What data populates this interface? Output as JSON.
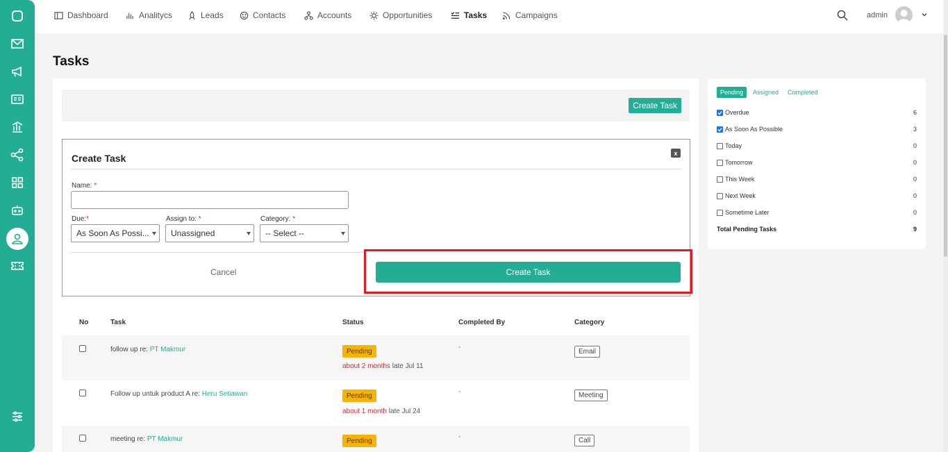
{
  "nav": {
    "items": [
      {
        "label": "Dashboard",
        "icon": "dashboard-icon"
      },
      {
        "label": "Analitycs",
        "icon": "analytics-icon"
      },
      {
        "label": "Leads",
        "icon": "rocket-icon"
      },
      {
        "label": "Contacts",
        "icon": "smiley-icon"
      },
      {
        "label": "Accounts",
        "icon": "hierarchy-icon"
      },
      {
        "label": "Opportunities",
        "icon": "sun-icon"
      },
      {
        "label": "Tasks",
        "icon": "tasks-icon"
      },
      {
        "label": "Campaigns",
        "icon": "rss-icon"
      }
    ],
    "user": "admin"
  },
  "page_title": "Tasks",
  "toolbar": {
    "create_label": "Create Task"
  },
  "form": {
    "title": "Create Task",
    "close": "x",
    "name_label": "Name:",
    "due_label": "Due:",
    "assign_label": "Assign to:",
    "category_label": "Category:",
    "required_mark": "*",
    "name_value": "",
    "due_value": "As Soon As Possi...",
    "assign_value": "Unassigned",
    "category_value": "-- Select --",
    "cancel_label": "Cancel",
    "submit_label": "Create Task"
  },
  "table": {
    "headers": [
      "No",
      "Task",
      "Status",
      "Completed By",
      "Category"
    ],
    "rows": [
      {
        "task": "follow up re: ",
        "link": "PT Makmur",
        "status": "Pending",
        "rel": "about 2 months",
        "late": " late Jul 11",
        "completed_by": "-",
        "category": "Email"
      },
      {
        "task": "Follow up untuk product A re: ",
        "link": "Heru Setiawan",
        "status": "Pending",
        "rel": "about 1 month",
        "late": " late Jul 24",
        "completed_by": "-",
        "category": "Meeting"
      },
      {
        "task": "meeting re: ",
        "link": "PT Makmur",
        "status": "Pending",
        "rel": "",
        "late": "",
        "completed_by": "-",
        "category": "Call"
      }
    ]
  },
  "summary": {
    "tabs": [
      "Pending",
      "Assigned",
      "Completed"
    ],
    "filters": [
      {
        "label": "Overdue",
        "count": "6",
        "checked": true
      },
      {
        "label": "As Soon As Possible",
        "count": "3",
        "checked": true
      },
      {
        "label": "Today",
        "count": "0",
        "checked": false
      },
      {
        "label": "Tomorrow",
        "count": "0",
        "checked": false
      },
      {
        "label": "This Week",
        "count": "0",
        "checked": false
      },
      {
        "label": "Next Week",
        "count": "0",
        "checked": false
      },
      {
        "label": "Sometime Later",
        "count": "0",
        "checked": false
      }
    ],
    "total_label": "Total Pending Tasks",
    "total_count": "9"
  },
  "colors": {
    "accent": "#23ad94",
    "badge": "#f6b300",
    "danger": "#d0263a",
    "highlight": "#e01b24"
  }
}
